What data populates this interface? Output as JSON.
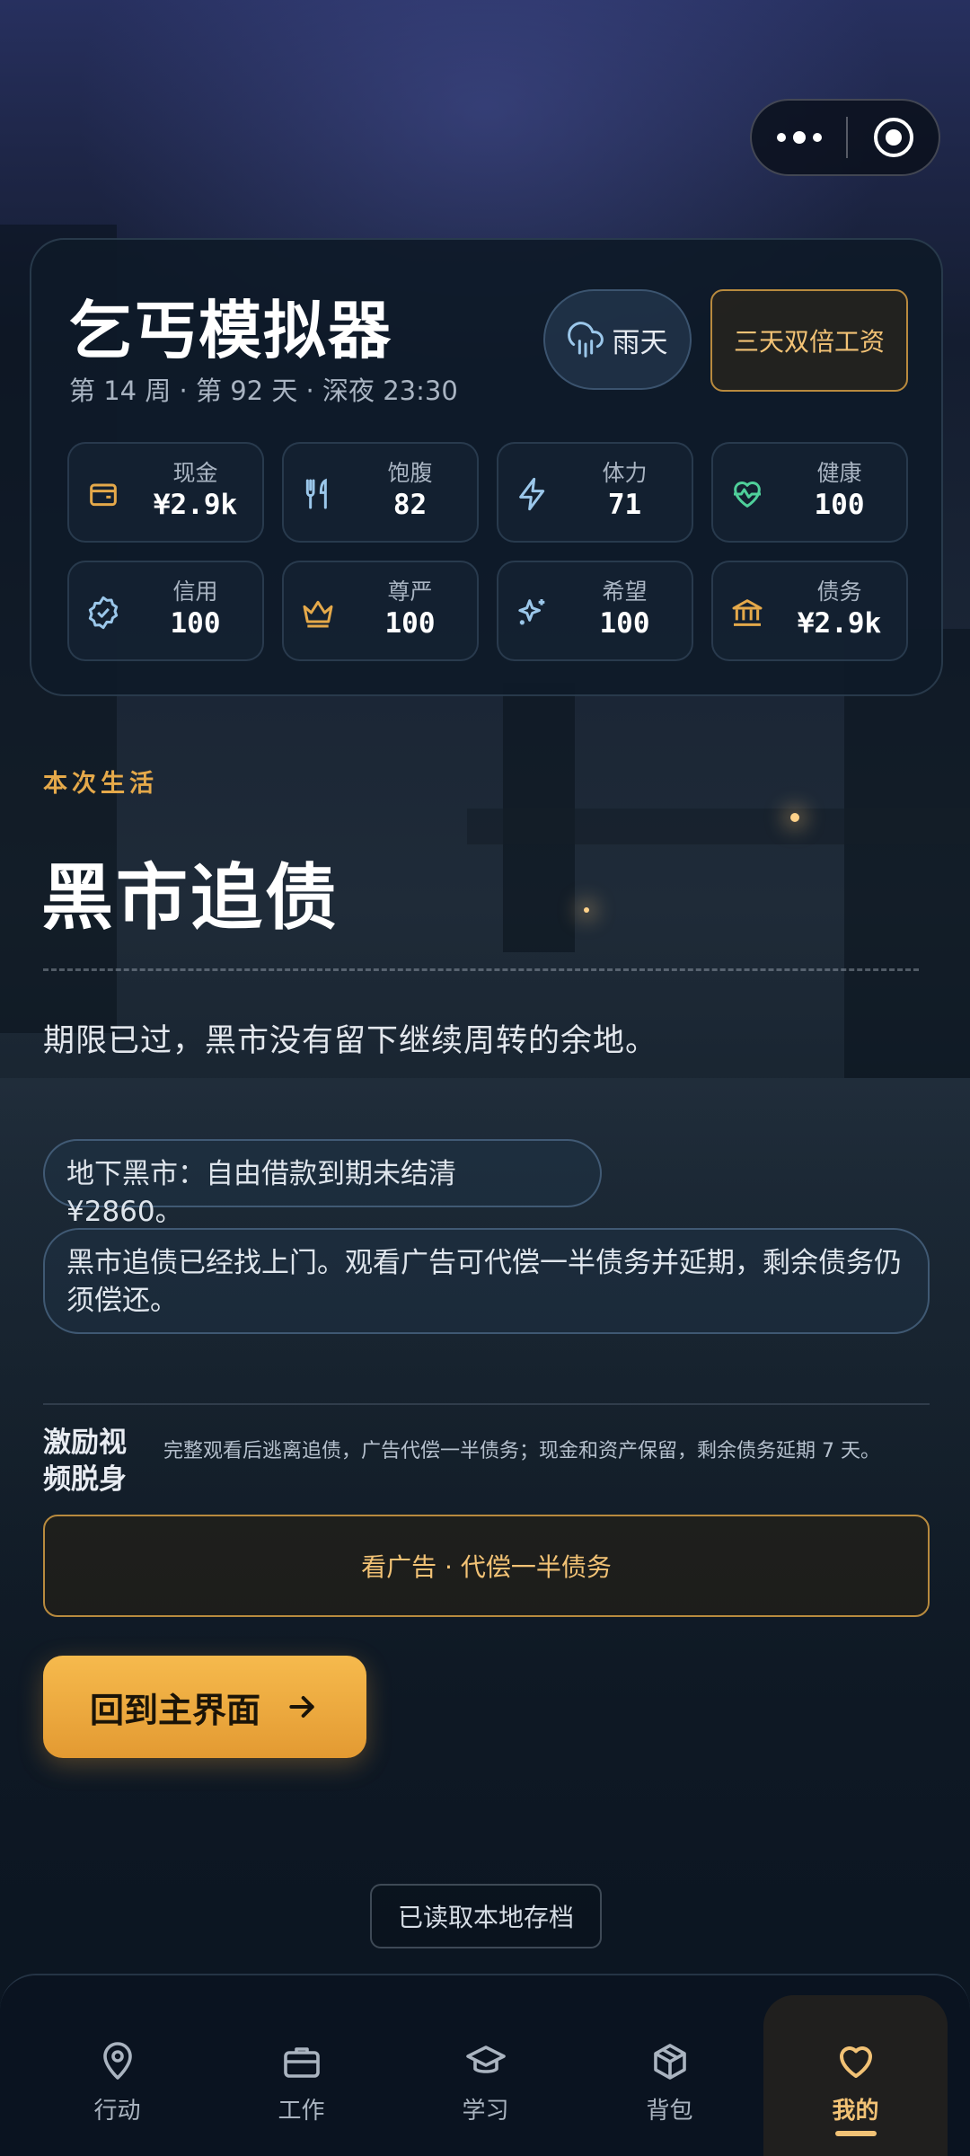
{
  "app": {
    "title": "乞丐模拟器",
    "subtitle": "第 14 周 · 第 92 天 · 深夜 23:30",
    "weather": "雨天",
    "bonus": "三天双倍工资"
  },
  "stats": [
    {
      "label": "现金",
      "value": "¥2.9k",
      "icon": "wallet-icon",
      "color": "#e5a94a"
    },
    {
      "label": "饱腹",
      "value": "82",
      "icon": "utensils-icon",
      "color": "#9bc7ea"
    },
    {
      "label": "体力",
      "value": "71",
      "icon": "lightning-icon",
      "color": "#9bc7ea"
    },
    {
      "label": "健康",
      "value": "100",
      "icon": "heart-pulse-icon",
      "color": "#4fcf9a"
    },
    {
      "label": "信用",
      "value": "100",
      "icon": "badge-check-icon",
      "color": "#9bc7ea"
    },
    {
      "label": "尊严",
      "value": "100",
      "icon": "crown-icon",
      "color": "#e5a94a"
    },
    {
      "label": "希望",
      "value": "100",
      "icon": "sparkles-icon",
      "color": "#9bc7ea"
    },
    {
      "label": "债务",
      "value": "¥2.9k",
      "icon": "bank-icon",
      "color": "#e5a94a"
    }
  ],
  "main": {
    "eyebrow": "本次生活",
    "headline": "黑市追债",
    "summary": "期限已过，黑市没有留下继续周转的余地。",
    "note1": "地下黑市：自由借款到期未结清 ¥2860。",
    "note2": "黑市追债已经找上门。观看广告可代偿一半债务并延期，剩余债务仍须偿还。",
    "incentive_title": "激励视频脱身",
    "incentive_desc": "完整观看后逃离追债，广告代偿一半债务；现金和资产保留，剩余债务延期 7 天。",
    "ad_button": "看广告 · 代偿一半债务",
    "home_button": "回到主界面",
    "save_status": "已读取本地存档"
  },
  "tabs": [
    {
      "label": "行动",
      "icon": "map-pin-icon"
    },
    {
      "label": "工作",
      "icon": "briefcase-icon"
    },
    {
      "label": "学习",
      "icon": "graduation-cap-icon"
    },
    {
      "label": "背包",
      "icon": "package-icon"
    },
    {
      "label": "我的",
      "icon": "heart-icon",
      "active": true
    }
  ],
  "colors": {
    "accent": "#f2c275",
    "accent_button": "#e9a43d",
    "card_bg": "#0e1a28",
    "text": "#e8ecf2"
  }
}
